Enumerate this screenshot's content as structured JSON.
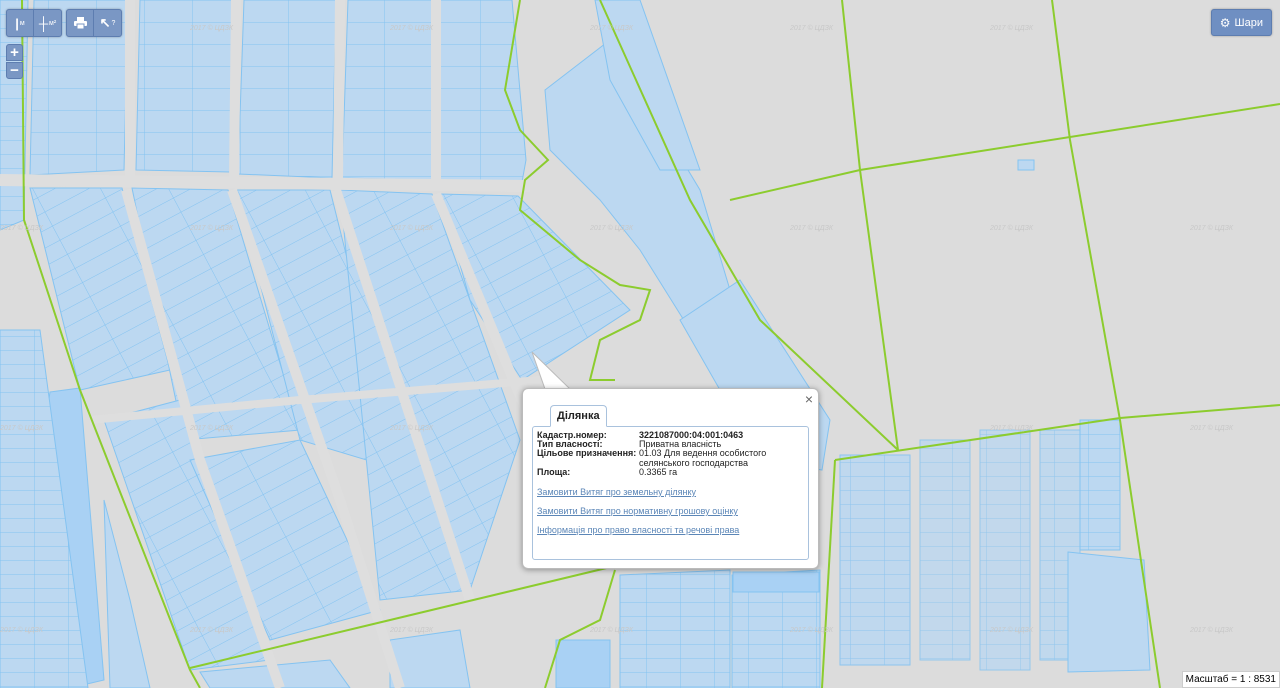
{
  "toolbar": {
    "measure_m_label": "м",
    "measure_area_label": "м²",
    "print_label": "Друк",
    "info_label": "?"
  },
  "zoom": {
    "in_label": "+",
    "out_label": "−"
  },
  "layers": {
    "label": "Шари",
    "icon": "gear-icon"
  },
  "watermark": "2017 © ЦДЗК",
  "popup": {
    "tab_title": "Ділянка",
    "close_label": "×",
    "fields": [
      {
        "label": "Кадастр.номер:",
        "value": "3221087000:04:001:0463"
      },
      {
        "label": "Тип власності:",
        "value": "Приватна власність"
      },
      {
        "label": "Цільове призначення:",
        "value": "01.03 Для ведення особистого селянського господарства"
      },
      {
        "label": "Площа:",
        "value": "0.3365 га"
      }
    ],
    "links": [
      "Замовити Витяг про земельну ділянку",
      "Замовити Витяг про нормативну грошову оцінку",
      "Інформація про право власності та речові права"
    ]
  },
  "scale": {
    "text": "Масштаб = 1 : 8531"
  },
  "colors": {
    "map_background": "#dcdcdc",
    "parcel_fill": "#bcd8f1",
    "parcel_fill_dark": "#a9d1f4",
    "parcel_stroke": "#84c3f1",
    "boundary_green": "#8ccc2e",
    "toolbar_blue": "#7a97c4"
  }
}
